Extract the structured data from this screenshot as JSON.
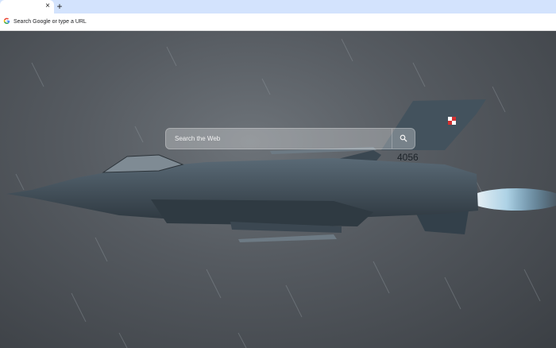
{
  "browser": {
    "tab_close_glyph": "×",
    "new_tab_glyph": "+",
    "omnibox_placeholder": "Search Google or type a URL",
    "omnibox_icon": "google-g-icon"
  },
  "newtab": {
    "search_placeholder": "Search the Web",
    "search_icon": "search-icon",
    "wallpaper": {
      "aircraft_tail_number": "4056"
    }
  },
  "colors": {
    "tabstrip": "#d3e3fd",
    "sky": "#565b61",
    "jet_body": "#3f4c57",
    "afterburner": "#bfe9ff"
  }
}
